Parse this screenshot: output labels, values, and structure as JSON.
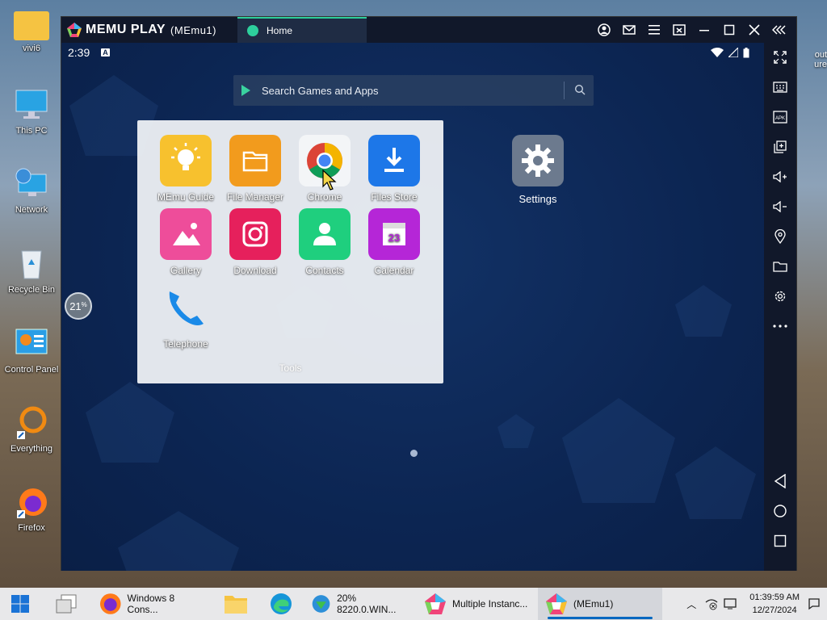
{
  "desktop": {
    "icons": [
      {
        "label": "vivi6"
      },
      {
        "label": "This PC"
      },
      {
        "label": "Network"
      },
      {
        "label": "Recycle Bin"
      },
      {
        "label": "Control Panel"
      },
      {
        "label": "Everything"
      },
      {
        "label": "Firefox"
      }
    ],
    "right_label": "out\nure"
  },
  "emulator": {
    "brand": "MEMU PLAY",
    "instance": "(MEmu1)",
    "tab": "Home",
    "controls": [
      "account-icon",
      "mail-icon",
      "menu-icon",
      "screen-icon",
      "minimize-icon",
      "maximize-icon",
      "close-icon",
      "collapse-icon"
    ],
    "android": {
      "time": "2:39",
      "notif": "A",
      "search_placeholder": "Search Games and Apps",
      "folder": {
        "name": "Tools",
        "apps": [
          {
            "label": "MEmu Guide",
            "color": "#f7c12e"
          },
          {
            "label": "File Manager",
            "color": "#f29b1d"
          },
          {
            "label": "Chrome",
            "color": "#ffffff"
          },
          {
            "label": "Files Store",
            "color": "#1d77e8"
          },
          {
            "label": "Gallery",
            "color": "#ee4d9a"
          },
          {
            "label": "Download",
            "color": "#e6205c"
          },
          {
            "label": "Contacts",
            "color": "#1fcf7e"
          },
          {
            "label": "Calendar",
            "color": "#b526d7"
          },
          {
            "label": "Telephone",
            "color": "#1a8ae8"
          }
        ]
      },
      "home_app": {
        "label": "Settings"
      },
      "cpu_badge": "21"
    },
    "sidebar": [
      "fullscreen-icon",
      "keyboard-icon",
      "apk-icon",
      "multi-instance-icon",
      "volume-up-icon",
      "volume-down-icon",
      "location-icon",
      "folder-icon",
      "settings-icon",
      "more-icon",
      "back-icon",
      "home-icon",
      "recent-icon"
    ]
  },
  "taskbar": {
    "items": [
      {
        "label": "Windows 8 Cons..."
      },
      {
        "label": "20% 8220.0.WIN..."
      },
      {
        "label": "Multiple Instanc..."
      },
      {
        "label": "(MEmu1)"
      }
    ],
    "time": "01:39:59 AM",
    "date": "12/27/2024"
  }
}
